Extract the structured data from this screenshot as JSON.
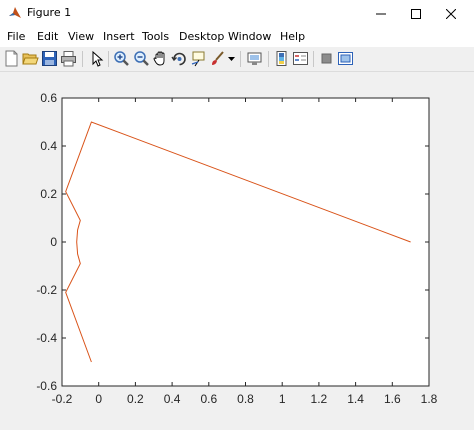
{
  "window": {
    "title": "Figure 1",
    "controls": [
      "minimize",
      "maximize",
      "close"
    ]
  },
  "menu": {
    "items": [
      "File",
      "Edit",
      "View",
      "Insert",
      "Tools",
      "Desktop",
      "Window",
      "Help"
    ]
  },
  "toolbar": {
    "buttons": [
      "new-figure",
      "open-file",
      "save",
      "print",
      "edit-plot",
      "zoom-in",
      "zoom-out",
      "pan",
      "rotate-3d",
      "data-cursor",
      "brush",
      "brush-dropdown",
      "link-plot",
      "insert-colorbar",
      "insert-legend",
      "hide-plot-tools",
      "show-plot-tools"
    ]
  },
  "colors": {
    "line": "#d95319",
    "axes_background": "#ffffff",
    "figure_background": "#f0f0f0"
  },
  "chart_data": {
    "type": "line",
    "xlim": [
      -0.2,
      1.8
    ],
    "ylim": [
      -0.6,
      0.6
    ],
    "x_ticks": [
      "-0.2",
      "0",
      "0.2",
      "0.4",
      "0.6",
      "0.8",
      "1",
      "1.2",
      "1.4",
      "1.6",
      "1.8"
    ],
    "y_ticks": [
      "0.6",
      "0.4",
      "0.2",
      "0",
      "-0.2",
      "-0.4",
      "-0.6"
    ],
    "grid": false,
    "series": [
      {
        "x": [
          1.7,
          -0.04,
          -0.18,
          -0.1,
          -0.115,
          -0.12,
          -0.115,
          -0.1,
          -0.18,
          -0.04
        ],
        "y": [
          0.0,
          0.5,
          0.21,
          0.09,
          0.05,
          0.0,
          -0.05,
          -0.09,
          -0.21,
          -0.5
        ]
      }
    ]
  }
}
